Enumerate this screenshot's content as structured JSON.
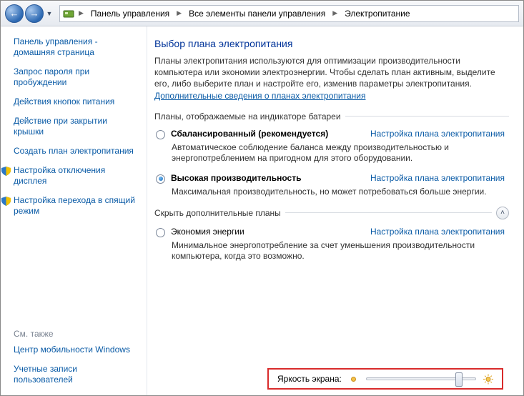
{
  "breadcrumb": {
    "items": [
      "Панель управления",
      "Все элементы панели управления",
      "Электропитание"
    ]
  },
  "sidebar": {
    "links": [
      "Панель управления - домашняя страница",
      "Запрос пароля при пробуждении",
      "Действия кнопок питания",
      "Действие при закрытии крышки",
      "Создать план электропитания",
      "Настройка отключения дисплея",
      "Настройка перехода в спящий режим"
    ],
    "see_also_label": "См. также",
    "see_also": [
      "Центр мобильности Windows",
      "Учетные записи пользователей"
    ]
  },
  "main": {
    "heading": "Выбор плана электропитания",
    "intro_text": "Планы электропитания используются для оптимизации производительности компьютера или экономии электроэнергии. Чтобы сделать план активным, выделите его, либо выберите план и настройте его, изменив параметры электропитания. ",
    "intro_link": "Дополнительные сведения о планах электропитания",
    "group1_label": "Планы, отображаемые на индикаторе батареи",
    "group2_label": "Скрыть дополнительные планы",
    "config_link": "Настройка плана электропитания",
    "plans": [
      {
        "title": "Сбалансированный (рекомендуется)",
        "desc": "Автоматическое соблюдение баланса между производительностью и энергопотреблением на пригодном для этого оборудовании.",
        "checked": false
      },
      {
        "title": "Высокая производительность",
        "desc": "Максимальная производительность, но может потребоваться больше энергии.",
        "checked": true
      }
    ],
    "extra_plans": [
      {
        "title": "Экономия энергии",
        "desc": "Минимальное энергопотребление за счет уменьшения производительности компьютера, когда это возможно."
      }
    ],
    "brightness_label": "Яркость экрана:"
  }
}
